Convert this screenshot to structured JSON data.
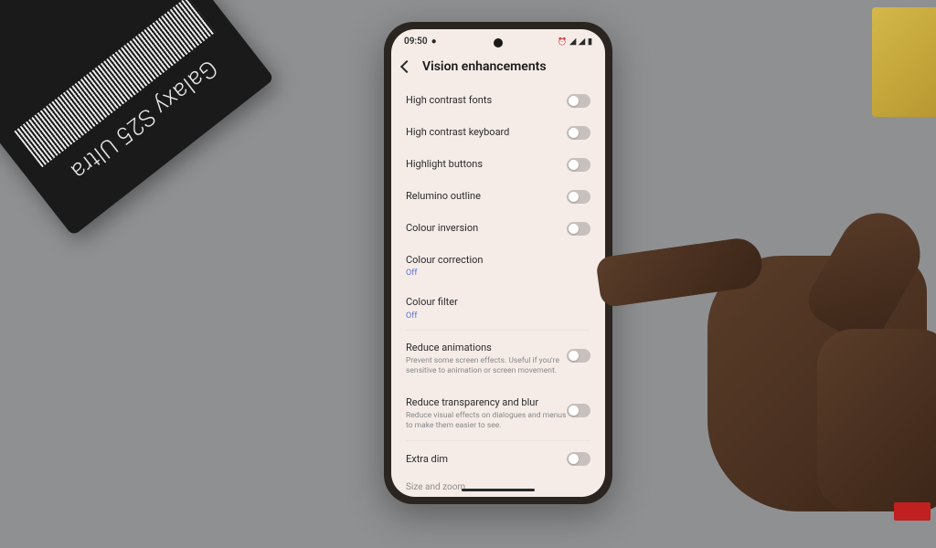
{
  "product_box": {
    "label": "Galaxy S25 Ultra"
  },
  "status_bar": {
    "time": "09:50"
  },
  "header": {
    "title": "Vision enhancements"
  },
  "settings": [
    {
      "label": "High contrast fonts",
      "type": "toggle",
      "on": false
    },
    {
      "label": "High contrast keyboard",
      "type": "toggle",
      "on": false
    },
    {
      "label": "Highlight buttons",
      "type": "toggle",
      "on": false
    },
    {
      "label": "Relumino outline",
      "type": "toggle",
      "on": false
    },
    {
      "label": "Colour inversion",
      "type": "toggle",
      "on": false
    },
    {
      "label": "Colour correction",
      "type": "link",
      "status": "Off"
    },
    {
      "label": "Colour filter",
      "type": "link",
      "status": "Off"
    },
    {
      "label": "Reduce animations",
      "type": "toggle",
      "on": false,
      "desc": "Prevent some screen effects. Useful if you're sensitive to animation or screen movement."
    },
    {
      "label": "Reduce transparency and blur",
      "type": "toggle",
      "on": false,
      "desc": "Reduce visual effects on dialogues and menus to make them easier to see."
    },
    {
      "label": "Extra dim",
      "type": "toggle",
      "on": false
    }
  ],
  "section_cut": "Size and zoom"
}
